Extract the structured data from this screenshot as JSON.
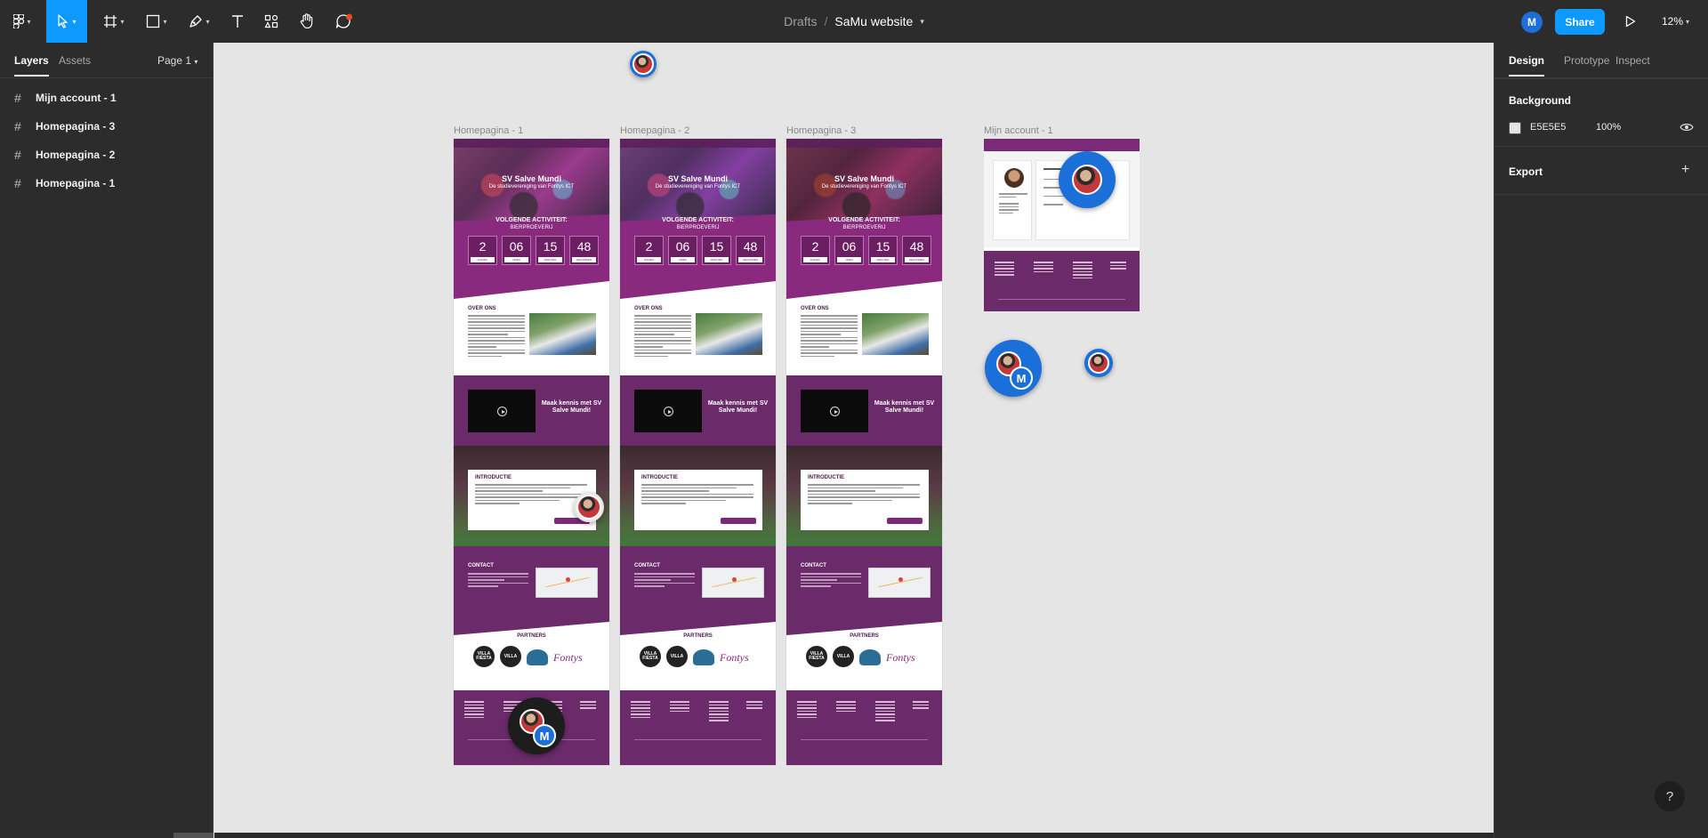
{
  "toolbar": {
    "title_folder": "Drafts",
    "title_separator": "/",
    "file_name": "SaMu website",
    "user_initial": "M",
    "share_label": "Share",
    "zoom": "12%",
    "tools": [
      "main-menu",
      "move",
      "frame",
      "shape",
      "pen",
      "text",
      "resources",
      "hand",
      "comment"
    ]
  },
  "left_panel": {
    "tabs": [
      "Layers",
      "Assets"
    ],
    "page_selector": "Page 1",
    "layers": [
      {
        "label": "Mijn account - 1"
      },
      {
        "label": "Homepagina - 3"
      },
      {
        "label": "Homepagina - 2"
      },
      {
        "label": "Homepagina - 1"
      }
    ]
  },
  "right_panel": {
    "tabs": [
      "Design",
      "Prototype",
      "Inspect"
    ],
    "background_heading": "Background",
    "background_hex": "E5E5E5",
    "background_opacity": "100%",
    "export_heading": "Export"
  },
  "canvas": {
    "frames": [
      {
        "label": "Homepagina - 1"
      },
      {
        "label": "Homepagina - 2"
      },
      {
        "label": "Homepagina - 3"
      }
    ],
    "account_frame_label": "Mijn account - 1",
    "frame_content": {
      "hero_title": "SV Salve Mundi",
      "hero_subtitle": "De studievereniging van Fontys ICT",
      "next_activity_heading": "VOLGENDE ACTIVITEIT:",
      "next_activity_name": "BIERPROEVERIJ",
      "countdown": [
        {
          "value": "2",
          "unit": "DAGEN"
        },
        {
          "value": "06",
          "unit": "UREN"
        },
        {
          "value": "15",
          "unit": "MINUTEN"
        },
        {
          "value": "48",
          "unit": "SECONDEN"
        }
      ],
      "about_heading": "OVER ONS",
      "video_heading": "Maak kennis met SV Salve Mundi!",
      "intro_heading": "INTRODUCTIE",
      "contact_heading": "CONTACT",
      "partners_heading": "PARTNERS",
      "partner_logos": [
        "VILLA FIESTA",
        "VILLA",
        "Fontys"
      ]
    }
  },
  "collaborators": {
    "badge_initial": "M"
  },
  "help_label": "?",
  "colors": {
    "accent": "#0d99ff",
    "toolbar": "#2c2c2c",
    "canvas_bg": "#e5e5e5",
    "brand_purple": "#6b2a6a"
  }
}
